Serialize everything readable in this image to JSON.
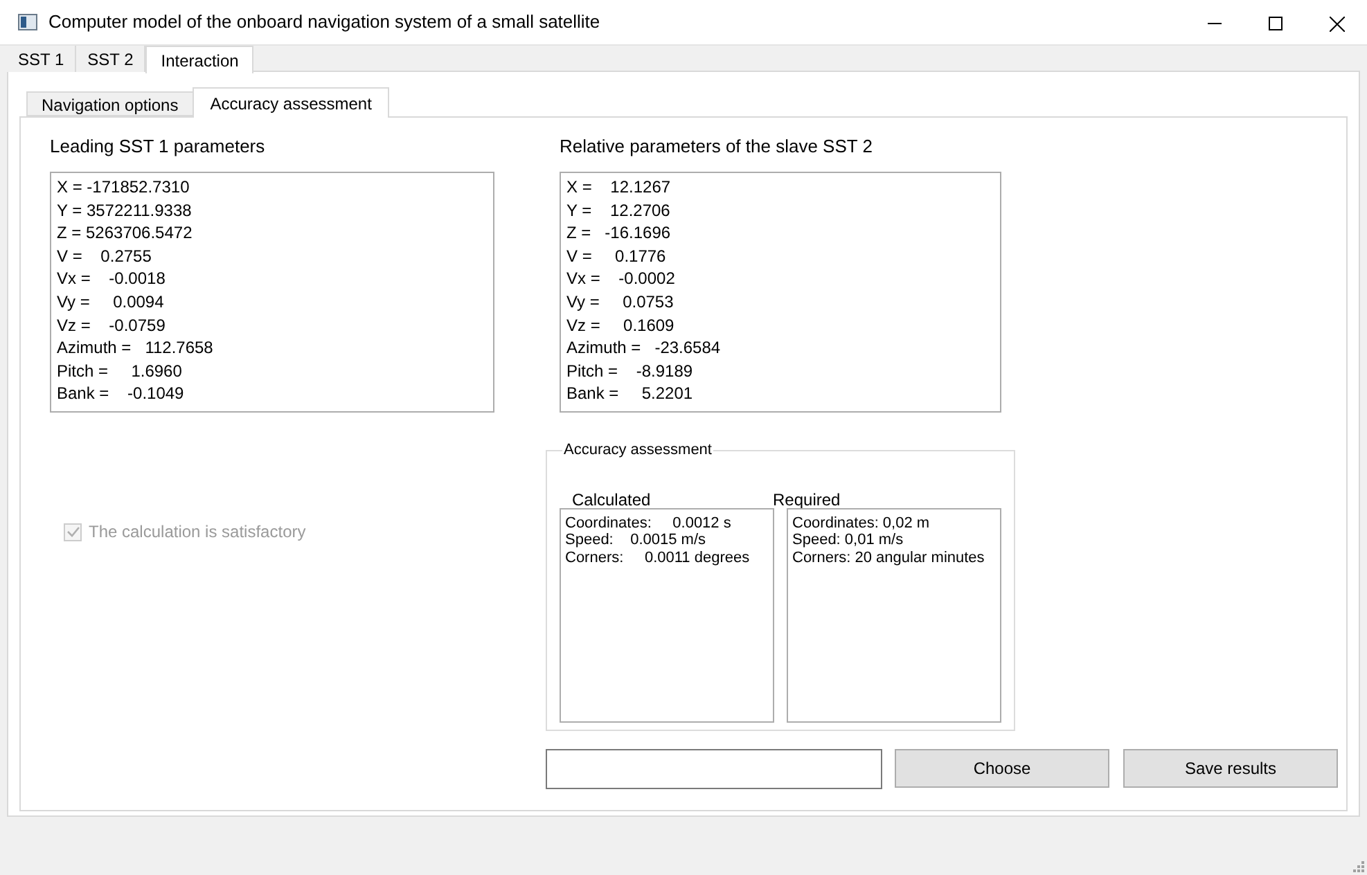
{
  "window": {
    "title": "Computer model of the onboard navigation system of a small satellite"
  },
  "tabs": [
    {
      "label": "SST 1",
      "selected": false
    },
    {
      "label": "SST 2",
      "selected": false
    },
    {
      "label": "Interaction",
      "selected": true
    }
  ],
  "subtabs": [
    {
      "label": "Navigation options",
      "selected": false
    },
    {
      "label": "Accuracy assessment",
      "selected": true
    }
  ],
  "leading_parameters": {
    "title": "Leading SST 1 parameters",
    "lines": [
      "X = -171852.7310",
      "Y = 3572211.9338",
      "Z = 5263706.5472",
      "V =    0.2755",
      "Vx =    -0.0018",
      "Vy =     0.0094",
      "Vz =    -0.0759",
      "Azimuth =   112.7658",
      "Pitch =     1.6960",
      "Bank =    -0.1049"
    ]
  },
  "relative_parameters": {
    "title": "Relative parameters of the slave SST 2",
    "lines": [
      "X =    12.1267",
      "Y =    12.2706",
      "Z =   -16.1696",
      "V =     0.1776",
      "Vx =    -0.0002",
      "Vy =     0.0753",
      "Vz =     0.1609",
      "Azimuth =   -23.6584",
      "Pitch =    -8.9189",
      "Bank =     5.2201"
    ]
  },
  "satisfactory_checkbox": {
    "label": "The calculation is satisfactory",
    "checked": true,
    "disabled": true
  },
  "accuracy_assessment": {
    "title": "Accuracy assessment",
    "calculated": {
      "label": "Calculated",
      "lines": [
        "Coordinates:     0.0012 s",
        "Speed:    0.0015 m/s",
        "Corners:     0.0011 degrees"
      ]
    },
    "required": {
      "label": "Required",
      "lines": [
        "Coordinates: 0,02 m",
        "Speed: 0,01 m/s",
        "Corners: 20 angular minutes"
      ]
    }
  },
  "buttons": [
    "Choose",
    "Save results"
  ]
}
